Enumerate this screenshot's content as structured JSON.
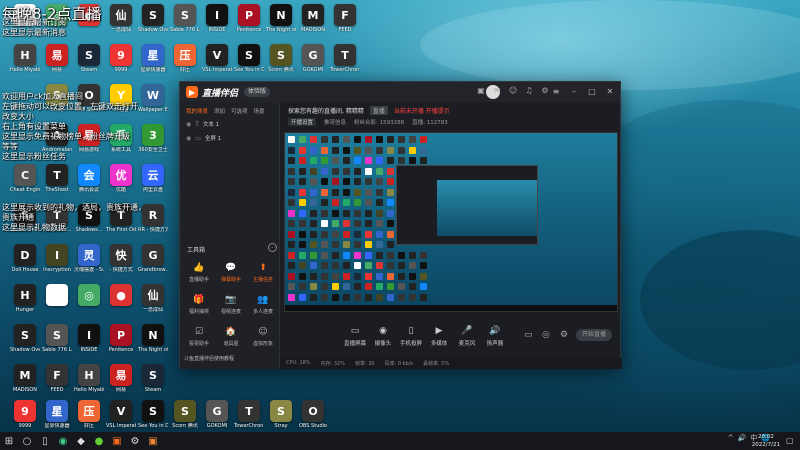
{
  "overlay": {
    "title": "每晚8-2点直播",
    "top_lines": [
      "这里显示最新订阅",
      "这里显示最新消息",
      "",
      "",
      "",
      ""
    ],
    "mid_lines": [
      "欢迎用户ck加入直播间",
      "左键拖动可以改变位置，左键双击打开",
      "改变大小",
      "右上角有设置菜单",
      "这里显示免费礼物榜单，粉丝牌升级",
      "等等",
      "这里显示粉丝任务"
    ],
    "gift_lines": [
      "这里展示收到的礼物，酒局，贵族开通，",
      "贵族开通",
      "这里显示礼物数据"
    ]
  },
  "desktop_icons": [
    {
      "label": "",
      "color": "#ffffff",
      "glyph": ""
    },
    {
      "label": "",
      "color": "#4a6",
      "glyph": "◎"
    },
    {
      "label": "",
      "color": "#d33",
      "glyph": "●"
    },
    {
      "label": "一念成仙",
      "color": "#333",
      "glyph": "仙"
    },
    {
      "label": "Shadow Overlord",
      "color": "#222",
      "glyph": "S"
    },
    {
      "label": "Sable 776 Launcher",
      "color": "#555",
      "glyph": "S"
    },
    {
      "label": "INSIDE",
      "color": "#111",
      "glyph": "I"
    },
    {
      "label": "Penitence",
      "color": "#a12",
      "glyph": "P"
    },
    {
      "label": "The Night of the Sto...",
      "color": "#111",
      "glyph": "N"
    },
    {
      "label": "MADISON",
      "color": "#222",
      "glyph": "M"
    },
    {
      "label": "FEED",
      "color": "#333",
      "glyph": "F"
    },
    {
      "label": "Hello Miyabi",
      "color": "#444",
      "glyph": "H"
    },
    {
      "label": "网易",
      "color": "#c22",
      "glyph": "易"
    },
    {
      "label": "Steam",
      "color": "#1b2838",
      "glyph": "S"
    },
    {
      "label": "9999",
      "color": "#e33",
      "glyph": "9"
    },
    {
      "label": "星际快速器",
      "color": "#36c",
      "glyph": "星"
    },
    {
      "label": "好压",
      "color": "#e63",
      "glyph": "压"
    },
    {
      "label": "VSL Imperative",
      "color": "#222",
      "glyph": "V"
    },
    {
      "label": "See You in Despair",
      "color": "#111",
      "glyph": "S"
    },
    {
      "label": "Scorn 腾讯",
      "color": "#552",
      "glyph": "S"
    },
    {
      "label": "GOKOMI",
      "color": "#555",
      "glyph": "G"
    },
    {
      "label": "TowerChron...",
      "color": "#333",
      "glyph": "T"
    },
    {
      "label": "Stray",
      "color": "#884",
      "glyph": "S"
    },
    {
      "label": "OBS Studio",
      "color": "#333",
      "glyph": "O"
    },
    {
      "label": "YY语音",
      "color": "#fc0",
      "glyph": "Y"
    },
    {
      "label": "Wallpaper Engine",
      "color": "#369",
      "glyph": "W"
    },
    {
      "label": "Andromaland",
      "color": "#222",
      "glyph": "A"
    },
    {
      "label": "网易游戏",
      "color": "#c22",
      "glyph": "易"
    },
    {
      "label": "系统工具",
      "color": "#2a6",
      "glyph": "系"
    },
    {
      "label": "360安全卫士",
      "color": "#393",
      "glyph": "3"
    },
    {
      "label": "Cheat Engine",
      "color": "#555",
      "glyph": "C"
    },
    {
      "label": "TheShost",
      "color": "#222",
      "glyph": "T"
    },
    {
      "label": "腾讯会议",
      "color": "#18f",
      "glyph": "会"
    },
    {
      "label": "优酷",
      "color": "#e3c",
      "glyph": "优"
    },
    {
      "label": "阿里云盘",
      "color": "#36f",
      "glyph": "云"
    },
    {
      "label": "Studio One 5",
      "color": "#222",
      "glyph": "5"
    },
    {
      "label": "TheyAreH...",
      "color": "#333",
      "glyph": "T"
    },
    {
      "label": "Shadows...",
      "color": "#111",
      "glyph": "S"
    },
    {
      "label": "The First Odyssey",
      "color": "#222",
      "glyph": "T"
    },
    {
      "label": "RR - 快捷方式",
      "color": "#333",
      "glyph": "R"
    },
    {
      "label": "Doll House",
      "color": "#222",
      "glyph": "D"
    },
    {
      "label": "Inscryption",
      "color": "#442",
      "glyph": "I"
    },
    {
      "label": "灵魂摆渡 - 5ub",
      "color": "#36c",
      "glyph": "灵"
    },
    {
      "label": "- 快捷方式",
      "color": "#333",
      "glyph": "快"
    },
    {
      "label": "Grandbrow...",
      "color": "#333",
      "glyph": "G"
    },
    {
      "label": "Hunger",
      "color": "#222",
      "glyph": "H"
    }
  ],
  "app": {
    "title": "直播伴侣",
    "version": "体验版",
    "scene_tabs": [
      "我的场景",
      "添加",
      "可选项",
      "场景"
    ],
    "scene_items": [
      {
        "label": "文本 1"
      },
      {
        "label": "全屏 1"
      }
    ],
    "toolbox_title": "工具箱",
    "tools": [
      {
        "label": "直播助手",
        "icon": "👍"
      },
      {
        "label": "弹幕助手",
        "icon": "💬"
      },
      {
        "label": "主播任务",
        "icon": "⬆"
      },
      {
        "label": "福利抽奖",
        "icon": "🎁"
      },
      {
        "label": "视频连麦",
        "icon": "📷"
      },
      {
        "label": "多人连麦",
        "icon": "👥"
      },
      {
        "label": "投票助手",
        "icon": "☑"
      },
      {
        "label": "道具屋",
        "icon": "🏠"
      },
      {
        "label": "虚拟形象",
        "icon": "☺"
      }
    ],
    "promo": "斗鱼直播伴侣使用教程",
    "top_info": {
      "text": "探索您有趣的直播间, 精精精",
      "tag": "直播",
      "warning": "当前未开播 开播提示"
    },
    "stats": {
      "btn": "开播设置",
      "a": "推流信息",
      "b": "粉丝合影: 1593288",
      "c": "直播: 112783"
    },
    "controls": [
      {
        "label": "直播屏幕",
        "icon": "▭"
      },
      {
        "label": "摄像头",
        "icon": "◉"
      },
      {
        "label": "手机投屏",
        "icon": "▯"
      },
      {
        "label": "多媒体",
        "icon": "▶"
      },
      {
        "label": "麦克风",
        "icon": "🎤"
      },
      {
        "label": "扬声器",
        "icon": "🔊"
      }
    ],
    "start_live": "开始直播",
    "status": [
      "CPU: 18%",
      "内存: 32%",
      "帧率: 30",
      "码率: 0 kb/s",
      "丢帧率: 0%"
    ]
  },
  "taskbar": {
    "tray": [
      "^",
      "🔊",
      "中",
      "🌐"
    ],
    "time": "20:02",
    "date": "2022/7/21"
  },
  "colors": {
    "accent": "#ff6a1a"
  }
}
